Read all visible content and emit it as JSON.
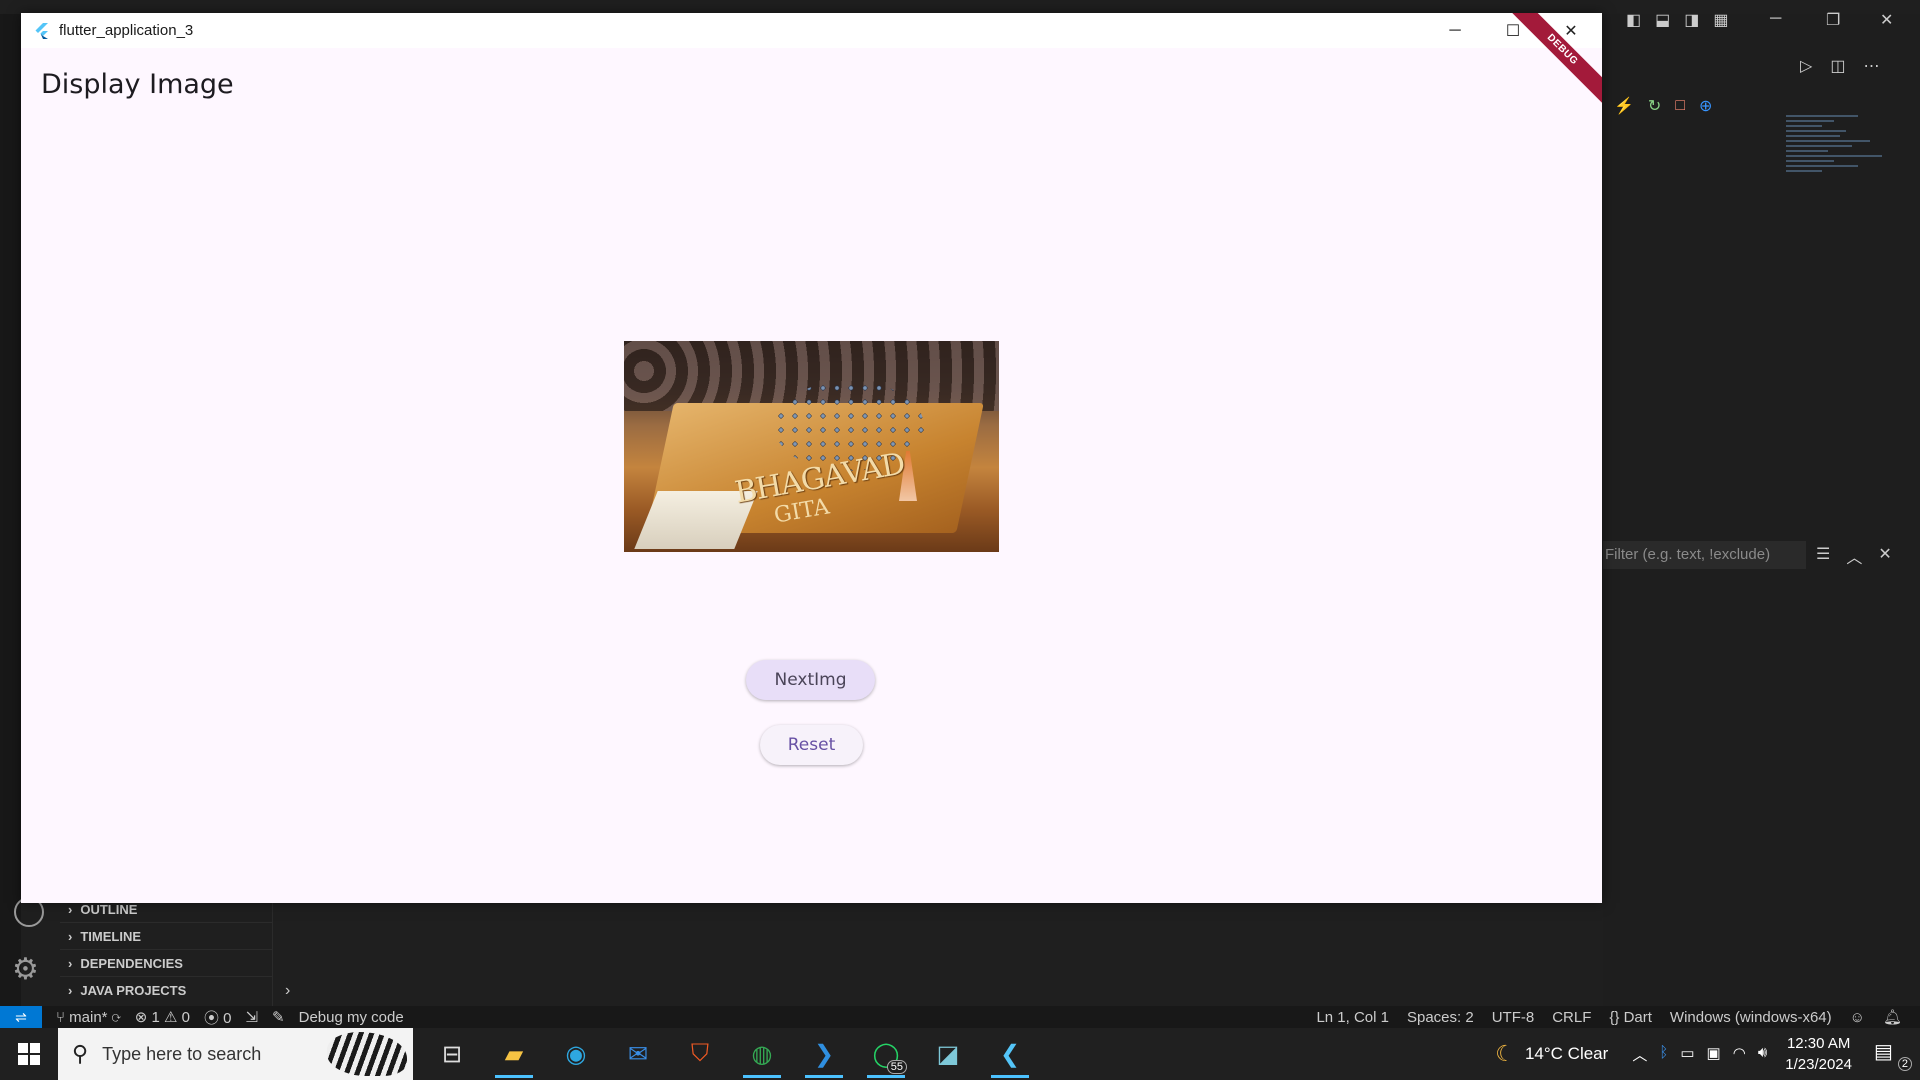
{
  "window": {
    "title": "flutter_application_3",
    "debug_banner": "DEBUG"
  },
  "app": {
    "page_title": "Display Image",
    "next_button": "NextImg",
    "reset_button": "Reset",
    "image_text_1": "BHAGAVAD",
    "image_text_2": "GITA"
  },
  "vscode": {
    "filter_placeholder": "Filter (e.g. text, !exclude)",
    "sidebar_sections": [
      "OUTLINE",
      "TIMELINE",
      "DEPENDENCIES",
      "JAVA PROJECTS"
    ],
    "statusbar": {
      "branch": "main*",
      "errors": "1",
      "warnings": "0",
      "ports": "0",
      "debug_text": "Debug my code",
      "position": "Ln 1, Col 1",
      "spaces": "Spaces: 2",
      "encoding": "UTF-8",
      "eol": "CRLF",
      "language": "Dart",
      "platform": "Windows (windows-x64)"
    }
  },
  "taskbar": {
    "search_placeholder": "Type here to search",
    "whatsapp_badge": "55",
    "weather": "14°C  Clear",
    "time": "12:30 AM",
    "date": "1/23/2024",
    "notification_count": "2"
  },
  "colors": {
    "app_background": "#fef7ff",
    "primary": "#6750a4",
    "tonal_button": "#e8def8",
    "vscode_accent": "#0078d4",
    "debug_banner": "#a31a3a"
  }
}
